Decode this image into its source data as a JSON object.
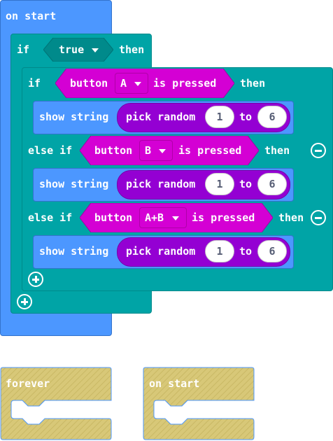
{
  "main_script": {
    "hat_label": "on start",
    "if_label": "if",
    "condition_value": "true",
    "then_label": "then",
    "inner_if": {
      "if_label": "if",
      "then_label": "then",
      "else_if_label": "else if",
      "branches": [
        {
          "button_label": "button",
          "button_value": "A",
          "pressed_label": "is pressed",
          "show_label": "show string",
          "random_label": "pick random",
          "from": "1",
          "to_label": "to",
          "to": "6"
        },
        {
          "button_label": "button",
          "button_value": "B",
          "pressed_label": "is pressed",
          "show_label": "show string",
          "random_label": "pick random",
          "from": "1",
          "to_label": "to",
          "to": "6"
        },
        {
          "button_label": "button",
          "button_value": "A+B",
          "pressed_label": "is pressed",
          "show_label": "show string",
          "random_label": "pick random",
          "from": "1",
          "to_label": "to",
          "to": "6"
        }
      ]
    }
  },
  "disabled_blocks": {
    "forever_label": "forever",
    "on_start_label": "on start"
  },
  "colors": {
    "events": "#4c97ff",
    "logic": "#00a4a6",
    "input": "#d400d4",
    "math": "#9400d3",
    "disabled": "#d8c878"
  }
}
